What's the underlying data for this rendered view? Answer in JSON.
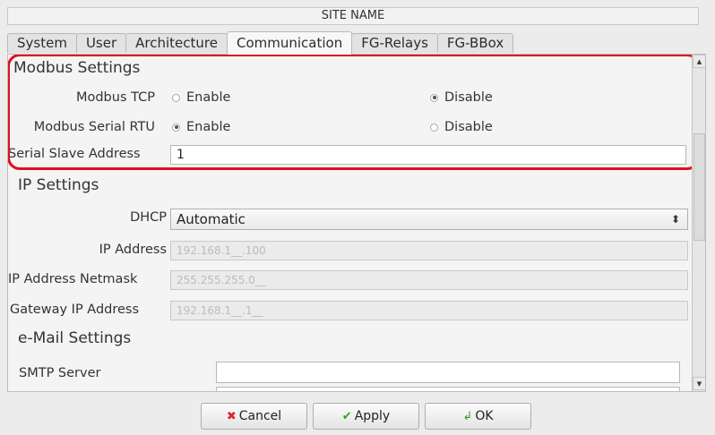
{
  "window": {
    "title": "SITE NAME"
  },
  "tabs": [
    {
      "label": "System",
      "active": false
    },
    {
      "label": "User",
      "active": false
    },
    {
      "label": "Architecture",
      "active": false
    },
    {
      "label": "Communication",
      "active": true
    },
    {
      "label": "FG-Relays",
      "active": false
    },
    {
      "label": "FG-BBox",
      "active": false
    }
  ],
  "modbus": {
    "title": "Modbus Settings",
    "tcp": {
      "label": "Modbus TCP",
      "enable": "Enable",
      "disable": "Disable",
      "selected": "Disable"
    },
    "serial_rtu": {
      "label": "Modbus Serial RTU",
      "enable": "Enable",
      "disable": "Disable",
      "selected": "Enable"
    },
    "slave_address": {
      "label": "Serial Slave Address",
      "value": "1"
    }
  },
  "ip": {
    "title": "IP Settings",
    "dhcp": {
      "label": "DHCP",
      "value": "Automatic"
    },
    "address": {
      "label": "IP Address",
      "value": "192.168.1__.100"
    },
    "netmask": {
      "label": "IP Address Netmask",
      "value": "255.255.255.0__"
    },
    "gateway": {
      "label": "Gateway IP Address",
      "value": "192.168.1__.1__"
    }
  },
  "email": {
    "title": "e-Mail Settings",
    "smtp": {
      "label": "SMTP Server",
      "value": ""
    }
  },
  "buttons": {
    "cancel": "Cancel",
    "apply": "Apply",
    "ok": "OK"
  },
  "colors": {
    "highlight": "#e0101e",
    "cancel_icon": "#d9282e",
    "check_icon": "#3a9a2a"
  },
  "icons": {
    "cancel": "cancel-circle-icon",
    "apply": "checkmark-icon",
    "ok": "ok-arrow-icon"
  }
}
